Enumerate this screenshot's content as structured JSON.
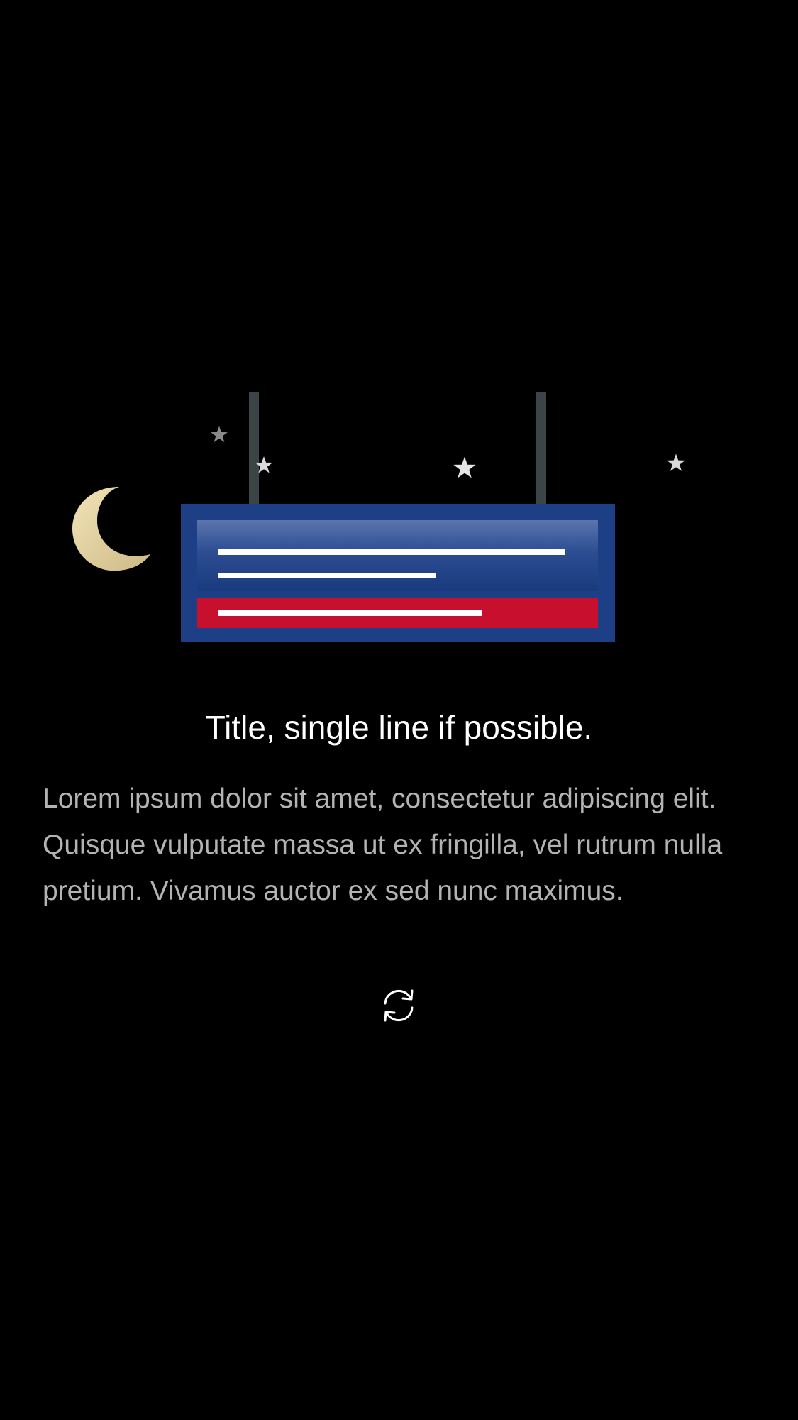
{
  "empty_state": {
    "title": "Title, single line if possible.",
    "body": "Lorem ipsum dolor sit amet, consectetur adipiscing elit. Quisque vulputate massa ut ex fringilla, vel rutrum nulla pretium. Vivamus auctor ex sed nunc maximus."
  },
  "refresh": {
    "icon": "refresh-icon"
  },
  "colors": {
    "background": "#000000",
    "sign_blue": "#1c3f86",
    "sign_red": "#c8102e",
    "moon": "#e6d6a6",
    "body_text": "#b3b3b3"
  }
}
